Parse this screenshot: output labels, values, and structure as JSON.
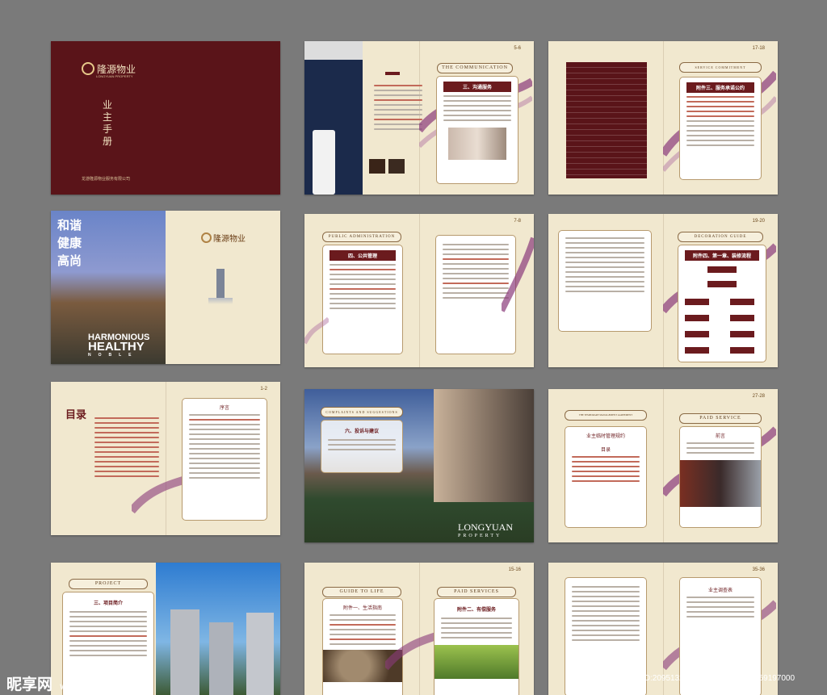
{
  "cover": {
    "logo_text": "隆源物业",
    "logo_sub": "LONGYUAN PROPERTY",
    "title_vertical": "业主手册",
    "company": "龙游隆源物业服务有限公司"
  },
  "spread2": {
    "page": "5-6",
    "banner": "THE COMMUNICATION",
    "card_title": "三、沟通服务"
  },
  "spread3": {
    "page": "17-18",
    "banner": "SERVICE COMMITMENT",
    "card_title": "附件三、服务承诺公约"
  },
  "spread4": {
    "slogan_1": "和谐",
    "slogan_2": "健康",
    "slogan_3": "高尚",
    "en_1": "HARMONIOUS",
    "en_2": "HEALTHY",
    "en_3": "NOBLE",
    "logo_text": "隆源物业"
  },
  "spread5": {
    "page": "7-8",
    "banner": "PUBLIC ADMINISTRATION",
    "card_title": "四、公共管理"
  },
  "spread6": {
    "page": "19-20",
    "banner": "DECORATION GUIDE",
    "card_title": "附件四、第一章、装修流程"
  },
  "spread7": {
    "page": "1-2",
    "toc_title": "目录",
    "card_title": "序言"
  },
  "spread8": {
    "banner": "COMPLAINTS AND SUGGESTIONS",
    "card_title": "六、投诉与建议",
    "brand_1": "LONGYUAN",
    "brand_2": "PROPERTY"
  },
  "spread9": {
    "page": "27-28",
    "banner_l": "THE TEMPORARY MANAGEMENT AGREEMENT",
    "banner_r": "PAID SERVICE",
    "card_title_l": "业主临时管理规约",
    "card_sub_l": "目录",
    "card_title_r": "前言"
  },
  "spread10": {
    "page": "3-4",
    "banner": "PROJECT",
    "card_title": "三、项目简介"
  },
  "spread11": {
    "page": "15-16",
    "banner_l": "GUIDE TO LIFE",
    "banner_r": "PAID SERVICES",
    "card_title_l": "附件一、生活指南",
    "card_title_r": "附件二、有偿服务"
  },
  "spread12": {
    "page": "35-36",
    "card_title_r": "业主调查表"
  },
  "watermark": {
    "logo": "昵享网",
    "url": "www.nipic.cn",
    "id": "ID:20951324 NO:20170408173859197000"
  },
  "colors": {
    "maroon": "#5a1419",
    "cream": "#f1e8cf",
    "purple": "#7a2a6a",
    "background": "#7a7a7a"
  }
}
